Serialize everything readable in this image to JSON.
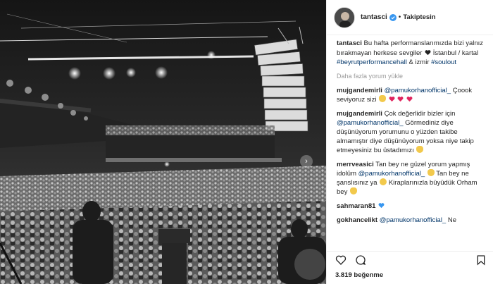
{
  "header": {
    "username": "tantasci",
    "separator": "•",
    "follow_state": "Takiptesin"
  },
  "caption": {
    "username": "tantasci",
    "text_1": "Bu hafta performanslarımızda bizi yalnız bırakmayan herkese sevgiler",
    "text_2": "İstanbul / kartal",
    "hashtag_1": "#beyrutperformancehall",
    "amp": "&",
    "text_3": "izmir",
    "hashtag_2": "#soulout"
  },
  "load_more": "Daha fazla yorum yükle",
  "comments": [
    {
      "username": "mujgandemirli",
      "mention": "@pamukorhanofficial_",
      "text": "Çoook seviyoruz sizi"
    },
    {
      "username": "mujgandemirli",
      "text_1": "Çok değerlidir bizler için",
      "mention": "@pamukorhanofficial_",
      "text_2": "Görmediniz diye düşünüyorum yorumunu o yüzden takibe almamıştır diye düşünüyorum yoksa niye takip etmeyesiniz bu üstadımızı"
    },
    {
      "username": "merrveasici",
      "text_1": "Tan bey ne güzel yorum yapmış idolüm",
      "mention": "@pamukorhanofficial_",
      "text_2": "Tan bey ne şanslısınız ya",
      "text_3": "Kiraplarınızla büyüdük Orham bey"
    },
    {
      "username": "sahmaran81",
      "text": ""
    },
    {
      "username": "gokhancelikt",
      "mention": "@pamukorhanofficial_",
      "text": "Ne"
    }
  ],
  "likes": "3.819 beğenme",
  "icons": {
    "verified": "verified-badge-icon",
    "like": "heart-icon",
    "comment": "comment-icon",
    "save": "bookmark-icon",
    "next": "chevron-right-icon"
  },
  "colors": {
    "link": "#003569",
    "verified": "#3897f0",
    "muted": "#999999",
    "border": "#efefef"
  }
}
